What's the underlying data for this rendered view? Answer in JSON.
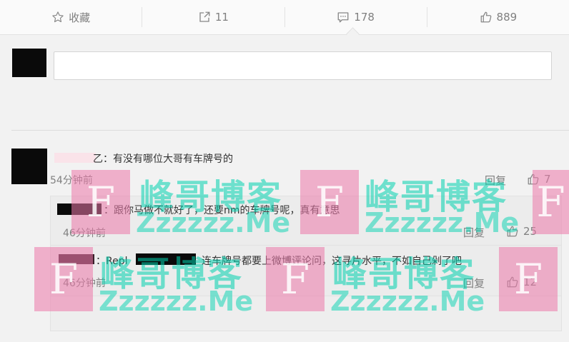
{
  "toolbar": {
    "favorite_label": "收藏",
    "repost_count": "11",
    "comment_count": "178",
    "like_count": "889"
  },
  "comments": [
    {
      "text": "乙：有没有哪位大哥有车牌号的",
      "time": "54分钟前",
      "reply_label": "回复",
      "likes": "7"
    }
  ],
  "replies": [
    {
      "text": "：跟你马做不就好了，还要nm的车牌号呢，真有意思",
      "time": "46分钟前",
      "reply_label": "回复",
      "likes": "25"
    },
    {
      "prefix": "：Repl",
      "text": "连车牌号都要上微博评论问，这寻片水平，不如自己剁了吧",
      "time": "46分钟前",
      "reply_label": "回复",
      "likes": "12"
    }
  ],
  "watermark": {
    "title": "峰哥博客",
    "url": "Zzzzzz.Me",
    "glyph": "F"
  },
  "colors": {
    "background": "#f2f2f2",
    "text": "#333333",
    "muted": "#808080",
    "watermark_green": "#00d2af",
    "watermark_pink": "#ec78aa"
  }
}
